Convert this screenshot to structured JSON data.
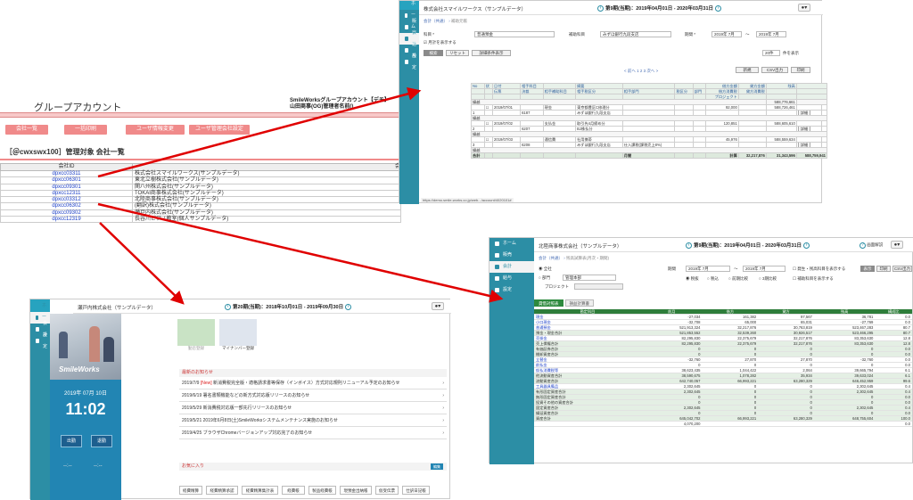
{
  "colors": {
    "arrow": "#e00000",
    "teal": "#2c8ea5",
    "pink": "#f08a8a",
    "green": "#2e7d3a"
  },
  "group": {
    "title": "グループアカウント",
    "header_right_1": "SmileWorksグループアカウント【デモ】",
    "header_right_2": "山田商事(OG)管理者名前()",
    "buttons": [
      "会社一覧",
      "一括印刷",
      "ユーザ情報変更",
      "ユーザ管理会社設定"
    ],
    "list_title": "［＠cwxswx100］管理対象 会社一覧",
    "col_id": "会社ID",
    "col_last": "会",
    "rows": [
      {
        "id": "dpxcc03311",
        "name": "株式会社スマイルワークス(サンプルデータ)"
      },
      {
        "id": "dpxcc06301",
        "name": "東北立樹株式会社(サンプルデータ)"
      },
      {
        "id": "dpxcc09301",
        "name": "関八州株式会社(サンプルデータ)"
      },
      {
        "id": "dpxcc12311",
        "name": "TOKAI商事株式会社(サンプルデータ)"
      },
      {
        "id": "dpxcc03312",
        "name": "北陸商事株式会社(サンプルデータ)"
      },
      {
        "id": "dpxcc06302",
        "name": "(翻訳)株式会社(サンプルデータ)"
      },
      {
        "id": "dpxcc09302",
        "name": "瀬戸内株式会社(サンプルデータ)"
      },
      {
        "id": "dpxcc12319",
        "name": "長谷川ピアノ教室(個人サンプルデータ)"
      }
    ]
  },
  "w1": {
    "sidebar": [
      "ホーム",
      "販売",
      "会計",
      "給与",
      "設定"
    ],
    "company": "株式会社スマイルワークス（サンプルデータ）",
    "period": "第9期(当期)：2019年04月01日 - 2020年03月31日",
    "breadcrumb_1": "会計（共通）",
    "breadcrumb_2": "補助元帳",
    "l_account": "科目 *",
    "v_account": "普通預金",
    "l_sub": "補助科目",
    "v_sub": "みずほ銀行九段支店",
    "l_term": "期間 *",
    "v_from": "2019年 7月",
    "v_to": "2019年 7月",
    "chk": "月計を表示する",
    "b_search": "検索",
    "b_reset": "リセット",
    "b_detail": "詳細条件表示",
    "per_page": "20件",
    "per_page_label": "件を表示",
    "pager": "< 前へ 1 2 3 次へ >",
    "b_new": "新規",
    "b_csv": "CSV出力",
    "b_print": "印刷",
    "head1": [
      "No",
      "状",
      "日付",
      "相手科目",
      "",
      "摘要",
      "",
      "",
      "",
      "借方金額",
      "貸方金額",
      "残高",
      ""
    ],
    "head2": [
      "",
      "",
      "伝票",
      "決裁",
      "相手補助科目",
      "相手税区分",
      "相手部門",
      "税区分",
      "部門",
      "借方消費税",
      "貸方消費税",
      "",
      ""
    ],
    "head3": [
      "",
      "",
      "",
      "",
      "",
      "",
      "",
      "",
      "",
      "プロジェクト",
      "",
      "",
      ""
    ],
    "carry": "繰越",
    "carry_bal": "588,776,661",
    "entries": [
      {
        "no": "1",
        "date": "2019/07/01",
        "acct": "現金",
        "desc": "東京都豊区C修理分",
        "dr": "92,000",
        "bal": "588,726,461",
        "v": "6187",
        "sub": "みずほ銀行九段支店",
        "btn": "詳細"
      },
      {
        "no": "2",
        "date": "2019/07/02",
        "acct": "支払金",
        "desc": "取引先4月締め分",
        "dr": "120,851",
        "bal": "588,605,610",
        "v": "6207",
        "sub": "BJ株払分",
        "btn": "詳細"
      },
      {
        "no": "3",
        "date": "2019/07/03",
        "acct": "通信費",
        "desc": "社用携帯",
        "dr": "45,976",
        "bal": "588,559,634",
        "v": "6208",
        "sub": "みずほ銀行九段支店",
        "tax": "仕入課税(課税売上8%)",
        "btn": "詳細"
      }
    ],
    "foot": [
      "合計",
      "",
      "",
      "",
      "",
      "",
      "月間",
      "",
      "",
      "計算",
      "32,217,876",
      "31,343,596",
      "588,759,941"
    ],
    "url": "https://demo.smile-works.co.jp/web.../account/4020101#"
  },
  "w2": {
    "sidebar": [
      "ホーム",
      "販売",
      "会計",
      "給与",
      "設定"
    ],
    "company": "北陸商事株式会社（サンプルデータ）",
    "period": "第9期(当期)：2019年04月01日 - 2020年03月31日",
    "help": "画面解説",
    "breadcrumb_1": "会計（共通）",
    "breadcrumb_2": "残高試算表(月次・期間)",
    "r_all": "全社",
    "r_dept": "部門",
    "dept": "管理本部",
    "project": "プロジェクト",
    "l_term": "期間",
    "v_from": "2019年 7月",
    "v_to": "2019年 7月",
    "opts": [
      "税抜",
      "税込",
      "前期比較",
      "3期比較"
    ],
    "chk1": "発生・残高科目を表示する",
    "chk2": "補助科目を表示する",
    "b_show": "表示",
    "b_print": "印刷",
    "b_csv": "CSV出力",
    "tabs": [
      "貸借対照表",
      "損益計算書"
    ],
    "head": [
      "勘定科目",
      "前月",
      "借方",
      "貸方",
      "残高",
      "構成比"
    ],
    "rows": [
      {
        "a": "現金",
        "n": 1,
        "v": [
          "-27,034",
          "161,382",
          "97,567",
          "36,781",
          "0.0"
        ]
      },
      {
        "a": "小口現金",
        "n": 1,
        "v": [
          "-32,708",
          "65,000",
          "65,031",
          "-27,769",
          "0.0"
        ]
      },
      {
        "a": "普通預金",
        "n": 1,
        "v": [
          "521,913,324",
          "32,217,876",
          "30,763,819",
          "523,467,283",
          "80.7"
        ]
      },
      {
        "a": "預金・現金合計",
        "n": 0,
        "v": [
          "521,853,552",
          "32,539,260",
          "30,926,517",
          "523,466,295",
          "80.7"
        ],
        "s": 1
      },
      {
        "a": "売掛金",
        "n": 1,
        "v": [
          "82,295,830",
          "22,375,679",
          "32,217,876",
          "83,353,630",
          "12.8"
        ]
      },
      {
        "a": "売上債権合計",
        "n": 0,
        "v": [
          "82,295,830",
          "22,375,679",
          "32,217,876",
          "83,353,630",
          "12.8"
        ],
        "s": 1
      },
      {
        "a": "有価証券合計",
        "n": 0,
        "v": [
          "0",
          "0",
          "0",
          "0",
          "0.0"
        ],
        "s": 1
      },
      {
        "a": "棚卸資産合計",
        "n": 0,
        "v": [
          "0",
          "0",
          "0",
          "0",
          "0.0"
        ],
        "s": 1
      },
      {
        "a": "立替金",
        "n": 1,
        "v": [
          "-32,760",
          "27,870",
          "27,870",
          "-32,760",
          "0.0"
        ]
      },
      {
        "a": "前払金",
        "n": 1,
        "v": [
          "0",
          "0",
          "0",
          "0",
          "0.0"
        ]
      },
      {
        "a": "仮払消費税等",
        "n": 1,
        "v": [
          "38,623,435",
          "1,044,422",
          "2,064",
          "39,665,794",
          "6.1"
        ]
      },
      {
        "a": "他流動資産合計",
        "n": 0,
        "v": [
          "38,590,675",
          "1,078,282",
          "35,934",
          "39,633,024",
          "6.1"
        ],
        "s": 1
      },
      {
        "a": "流動資産合計",
        "n": 0,
        "v": [
          "642,740,057",
          "66,993,221",
          "63,280,329",
          "646,452,959",
          "99.6"
        ],
        "s": 1
      },
      {
        "a": "工具器具備品",
        "n": 1,
        "v": [
          "2,302,645",
          "0",
          "0",
          "2,302,645",
          "0.4"
        ]
      },
      {
        "a": "有形固定資産合計",
        "n": 0,
        "v": [
          "2,302,645",
          "0",
          "0",
          "2,302,645",
          "0.4"
        ],
        "s": 1
      },
      {
        "a": "無形固定資産合計",
        "n": 0,
        "v": [
          "0",
          "0",
          "0",
          "0",
          "0.0"
        ],
        "s": 1
      },
      {
        "a": "投資その他の資産合計",
        "n": 0,
        "v": [
          "0",
          "0",
          "0",
          "0",
          "0.0"
        ],
        "s": 1
      },
      {
        "a": "固定資産合計",
        "n": 0,
        "v": [
          "2,302,645",
          "0",
          "0",
          "2,302,645",
          "0.4"
        ],
        "s": 1
      },
      {
        "a": "繰延資産合計",
        "n": 0,
        "v": [
          "0",
          "0",
          "0",
          "0",
          "0.0"
        ],
        "s": 1
      },
      {
        "a": "資産合計",
        "n": 0,
        "v": [
          "645,042,702",
          "66,993,221",
          "63,280,329",
          "648,755,604",
          "100.0"
        ],
        "s": 1
      },
      {
        "a": "",
        "n": 0,
        "v": [
          "4,070,200",
          "",
          "",
          "",
          "0.0"
        ]
      }
    ]
  },
  "w3": {
    "sidebar": [
      "ホーム",
      "会計",
      "設定"
    ],
    "company": "瀬戸内株式会社（サンプルデータ）",
    "period": "第20期(当期)：2018年10月01日 - 2019年09月30日",
    "brand": "SmileWorks",
    "date": "2019年 07月 10日",
    "time": "11:02",
    "in": "出勤",
    "out": "退勤",
    "dash": "--:--",
    "tiles": [
      "勤怠登録",
      "マイナンバー登録"
    ],
    "news_title": "最新のお知らせ",
    "news": [
      {
        "date": "2019/7/9",
        "tag": "[New]",
        "text": "新消費税完全版・適格請求書等保存（インボイス）方式対応規則リニューアル予定のお知らせ"
      },
      {
        "date": "2019/6/19",
        "tag": "",
        "text": "署名書類機能などの新方式対応版リリースのお知らせ"
      },
      {
        "date": "2019/5/29",
        "tag": "",
        "text": "新消費税対応版一部先行リリースのお知らせ"
      },
      {
        "date": "2019/5/21",
        "tag": "",
        "text": "2019年6月8日(土)SmileWorksシステムメンテナンス実施のお知らせ"
      },
      {
        "date": "2019/4/25",
        "tag": "",
        "text": "ブラウザChromeバージョンアップ対応完了のお知らせ"
      }
    ],
    "fav_title": "お気に入り",
    "fav_edit": "編集",
    "favs": [
      "経費精算",
      "経費精算承認",
      "経費精算集計表",
      "経費帳",
      "製品経費帳",
      "現預金出納帳",
      "仮受伝票",
      "仕訳日記帳"
    ]
  }
}
